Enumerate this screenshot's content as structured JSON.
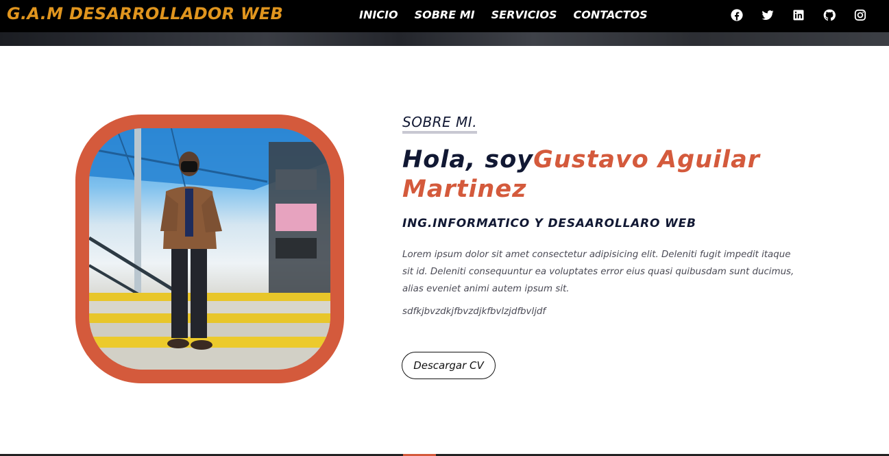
{
  "header": {
    "brand": "G.A.M DESARROLLADOR WEB",
    "nav": [
      {
        "label": "INICIO"
      },
      {
        "label": "SOBRE MI"
      },
      {
        "label": "SERVICIOS"
      },
      {
        "label": "CONTACTOS"
      }
    ],
    "socials": [
      "facebook-icon",
      "twitter-icon",
      "linkedin-icon",
      "github-icon",
      "instagram-icon"
    ]
  },
  "about": {
    "section_label": "SOBRE MI.",
    "greeting": "Hola, soy",
    "name": "Gustavo Aguilar Martinez",
    "role": "ING.INFORMATICO Y DESAAROLLARO WEB",
    "paragraph": "Lorem ipsum dolor sit amet consectetur adipisicing elit. Deleniti fugit impedit itaque sit id. Deleniti consequuntur ea voluptates error eius quasi quibusdam sunt ducimus, alias eveniet animi autem ipsum sit.",
    "paragraph2": "sdfkjbvzdkjfbvzdjkfbvlzjdfbvljdf",
    "cv_button": "Descargar CV"
  },
  "colors": {
    "brand": "#e0951e",
    "accent": "#d45a3c",
    "navy": "#111833",
    "header_bg": "#000000"
  }
}
